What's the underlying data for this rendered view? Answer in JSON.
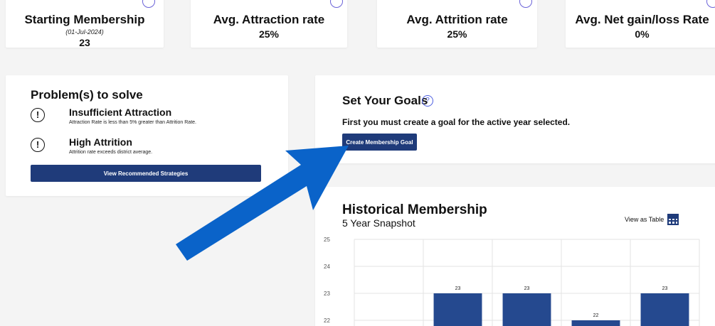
{
  "stats": [
    {
      "title": "Starting Membership",
      "date": "(01-Jul-2024)",
      "value": "23"
    },
    {
      "title": "Avg. Attraction rate",
      "date": "",
      "value": "25%"
    },
    {
      "title": "Avg. Attrition rate",
      "date": "",
      "value": "25%"
    },
    {
      "title": "Avg. Net gain/loss Rate",
      "date": "",
      "value": "0%"
    }
  ],
  "problems": {
    "title": "Problem(s) to solve",
    "items": [
      {
        "icon": "!",
        "title": "Insufficient Attraction",
        "desc": "Attraction Rate is less than 5% greater than Attrition Rate."
      },
      {
        "icon": "!",
        "title": "High Attrition",
        "desc": "Attrition rate exceeds district average."
      }
    ],
    "button_label": "View Recommended Strategies"
  },
  "goals": {
    "title": "Set Your Goals",
    "help_glyph": "?",
    "text": "First you must create a goal for the active year selected.",
    "button_label": "Create Membership Goal"
  },
  "history": {
    "title": "Historical Membership",
    "subtitle": "5 Year Snapshot",
    "view_table_label": "View as Table"
  },
  "colors": {
    "primary": "#1f3b7a",
    "bar": "#25498f",
    "arrow": "#0a63c9"
  },
  "chart_data": {
    "type": "bar",
    "categories": [
      "",
      "",
      "",
      "",
      ""
    ],
    "values": [
      null,
      23,
      23,
      22,
      23
    ],
    "data_labels": [
      "",
      "23",
      "23",
      "22",
      "23"
    ],
    "y_ticks": [
      "25",
      "24",
      "23",
      "22"
    ],
    "ylim": [
      21.8,
      25
    ],
    "grid": true
  }
}
